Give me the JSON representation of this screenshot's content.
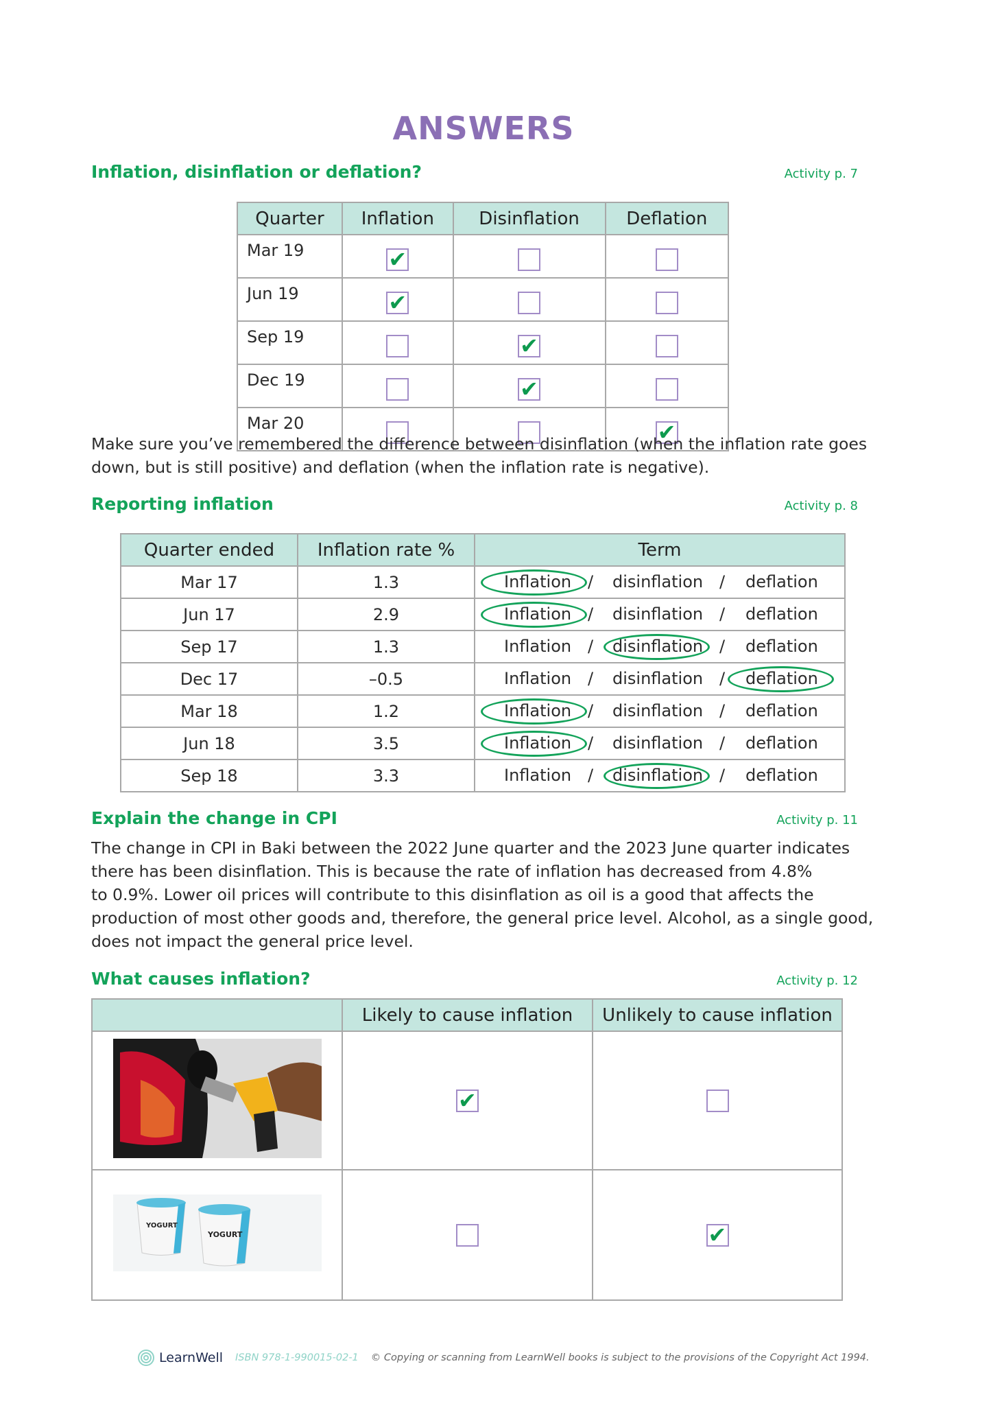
{
  "page": {
    "title": "ANSWERS",
    "colors": {
      "title": "#8b6fb5",
      "heading": "#13a35a",
      "table_header": "#c4e6df",
      "checkbox_border": "#a28cc7",
      "tick": "#0e9a4e"
    }
  },
  "sections": [
    {
      "title": "Inflation, disinflation or deflation?",
      "activity": "Activity p. 7",
      "table": {
        "headers": [
          "Quarter",
          "Inflation",
          "Disinflation",
          "Deflation"
        ],
        "rows": [
          {
            "quarter": "Mar 19",
            "checked": [
              true,
              false,
              false
            ]
          },
          {
            "quarter": "Jun 19",
            "checked": [
              true,
              false,
              false
            ]
          },
          {
            "quarter": "Sep 19",
            "checked": [
              false,
              true,
              false
            ]
          },
          {
            "quarter": "Dec 19",
            "checked": [
              false,
              true,
              false
            ]
          },
          {
            "quarter": "Mar 20",
            "checked": [
              false,
              false,
              true
            ]
          }
        ]
      },
      "note": "Make sure you’ve remembered the difference between disinflation (when the inflation rate goes down, but is still positive) and deflation (when the inflation rate is negative)."
    },
    {
      "title": "Reporting inflation",
      "activity": "Activity p. 8",
      "table": {
        "headers": [
          "Quarter ended",
          "Inflation rate %",
          "Term"
        ],
        "term_options": [
          "Inflation",
          "disinflation",
          "deflation"
        ],
        "separator": "/",
        "rows": [
          {
            "quarter": "Mar 17",
            "rate": "1.3",
            "circled": 0
          },
          {
            "quarter": "Jun 17",
            "rate": "2.9",
            "circled": 0
          },
          {
            "quarter": "Sep 17",
            "rate": "1.3",
            "circled": 1
          },
          {
            "quarter": "Dec 17",
            "rate": "–0.5",
            "circled": 2
          },
          {
            "quarter": "Mar 18",
            "rate": "1.2",
            "circled": 0
          },
          {
            "quarter": "Jun 18",
            "rate": "3.5",
            "circled": 0
          },
          {
            "quarter": "Sep 18",
            "rate": "3.3",
            "circled": 1
          }
        ]
      }
    },
    {
      "title": "Explain the change in CPI",
      "activity": "Activity p. 11",
      "lines": [
        "The change in CPI in Baki between the 2022 June quarter and the 2023 June quarter indicates",
        "there has been disinflation. This is because the rate of inflation has decreased from 4.8%",
        "to 0.9%. Lower oil prices will contribute to this disinflation as oil is a good that affects the",
        "production of most other goods and, therefore, the general price level. Alcohol, as a single good,",
        "does not impact the general price level."
      ]
    },
    {
      "title": "What causes inflation?",
      "activity": "Activity p. 12",
      "table": {
        "headers": [
          "",
          "Likely to cause inflation",
          "Unlikely to cause inflation"
        ],
        "rows": [
          {
            "image": "fuel-pump-photo",
            "likely": true,
            "unlikely": false
          },
          {
            "image": "yogurt-cups-photo",
            "image_label": "YOGURT",
            "likely": false,
            "unlikely": true
          }
        ]
      }
    }
  ],
  "footer": {
    "brand": "LearnWell",
    "isbn": "ISBN 978-1-990015-02-1",
    "copyright": "© Copying or scanning from LearnWell books is subject to the provisions of the Copyright Act 1994."
  },
  "tick_glyph": "✔"
}
